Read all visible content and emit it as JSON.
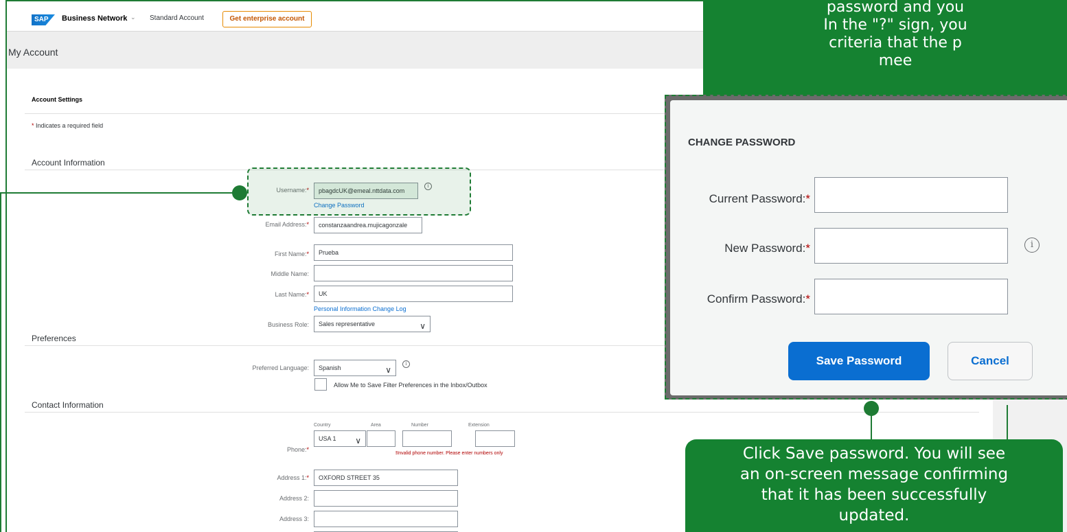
{
  "header": {
    "logo_text": "SAP",
    "product": "Business Network",
    "product_caret": "⌄",
    "account_type": "Standard Account",
    "enterprise_button": "Get enterprise account"
  },
  "page_title": "My Account",
  "account_settings": {
    "title": "Account Settings",
    "required_note": "Indicates a required field",
    "required_marker": "*"
  },
  "account_info": {
    "title": "Account Information",
    "username_label": "Username:",
    "username_value": "pbagdcUK@emeal.nttdata.com",
    "change_password_link": "Change Password",
    "email_label": "Email Address:",
    "email_value": "constanzaandrea.mujicagonzale",
    "first_name_label": "First Name:",
    "first_name_value": "Prueba",
    "middle_name_label": "Middle Name:",
    "middle_name_value": "",
    "last_name_label": "Last Name:",
    "last_name_value": "UK",
    "change_log_link": "Personal Information Change Log",
    "business_role_label": "Business Role:",
    "business_role_value": "Sales representative"
  },
  "preferences": {
    "title": "Preferences",
    "language_label": "Preferred Language:",
    "language_value": "Spanish",
    "filter_checkbox_label": "Allow Me to Save Filter Preferences in the Inbox/Outbox"
  },
  "contact": {
    "title": "Contact Information",
    "phone_label": "Phone:",
    "country_head": "Country",
    "area_head": "Area",
    "number_head": "Number",
    "extension_head": "Extension",
    "country_value": "USA 1",
    "phone_error": "Invalid phone number. Please enter numbers only",
    "address1_label": "Address 1:",
    "address1_value": "OXFORD STREET 35",
    "address2_label": "Address 2:",
    "address3_label": "Address 3:"
  },
  "modal": {
    "title": "CHANGE PASSWORD",
    "current_label": "Current Password:",
    "new_label": "New Password:",
    "confirm_label": "Confirm Password:",
    "save_button": "Save Password",
    "cancel_button": "Cancel",
    "info_glyph": "i"
  },
  "callouts": {
    "top_lines": [
      "password and you",
      "In the \"?\" sign, you",
      "criteria that the p",
      "mee"
    ],
    "bottom_lines": [
      "Click Save password. You will see",
      "an on-screen message confirming",
      "that it has been successfully",
      "updated."
    ]
  },
  "colors": {
    "callout_green": "#158231",
    "sap_blue": "#0a6ed1",
    "required_red": "#b00000",
    "enterprise_orange": "#e68a00"
  }
}
